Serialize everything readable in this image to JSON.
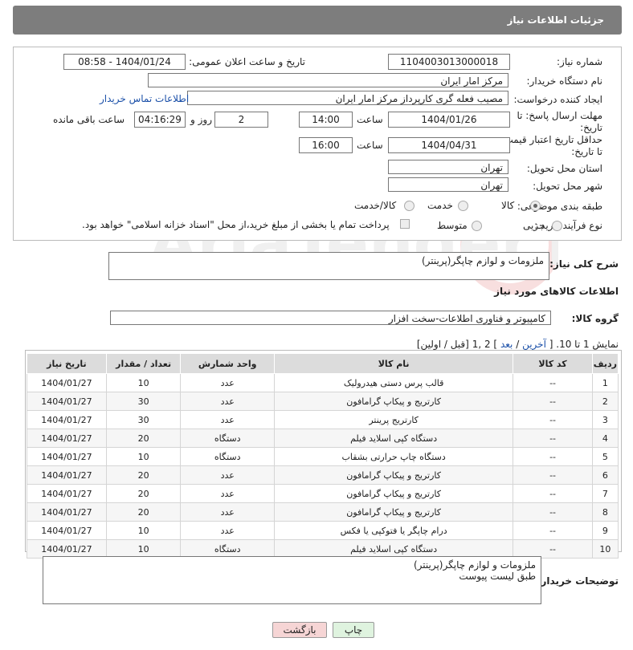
{
  "header": {
    "title": "جزئیات اطلاعات نیاز"
  },
  "form": {
    "need_number_label": "شماره نیاز:",
    "need_number": "1104003013000018",
    "announce_label": "تاریخ و ساعت اعلان عمومی:",
    "announce_value": "1404/01/24 - 08:58",
    "buyer_org_label": "نام دستگاه خریدار:",
    "buyer_org": "مرکز امار ایران",
    "creator_label": "ایجاد کننده درخواست:",
    "creator": "مصیب فعله گری کارپرداز مرکز امار ایران",
    "contact_link": "اطلاعات تماس خریدار",
    "deadline_label_1": "مهلت ارسال پاسخ: تا",
    "deadline_label_2": "تاریخ:",
    "deadline_date": "1404/01/26",
    "time_label": "ساعت",
    "deadline_time": "14:00",
    "days_value": "2",
    "days_label": "روز و",
    "remaining_time": "04:16:29",
    "remaining_label": "ساعت باقی مانده",
    "price_valid_label_1": "حداقل تاریخ اعتبار قیمت:",
    "price_valid_label_2": "تا تاریخ:",
    "price_valid_date": "1404/04/31",
    "price_valid_time": "16:00",
    "province_label": "استان محل تحویل:",
    "province": "تهران",
    "city_label": "شهر محل تحویل:",
    "city": "تهران",
    "category_label": "طبقه بندی موضوعی:",
    "category_options": [
      "کالا",
      "خدمت",
      "کالا/خدمت"
    ],
    "process_label": "نوع فرآیند خرید :",
    "process_options": [
      "جزیی",
      "متوسط"
    ],
    "payment_note": "پرداخت تمام یا بخشی از مبلغ خرید،از محل \"اسناد خزانه اسلامی\" خواهد بود."
  },
  "description": {
    "label": "شرح کلی نیاز:",
    "value": "ملزومات و لوازم چاپگر(پرینتر)"
  },
  "goods_info_title": "اطلاعات کالاهای مورد نیاز",
  "goods_group": {
    "label": "گروه کالا:",
    "value": "کامپیوتر و فناوری اطلاعات-سخت افزار"
  },
  "pagination": {
    "prefix": "نمایش 1 تا 10. [",
    "last": "آخرین",
    "sep1": " / ",
    "next": "بعد",
    "pages": "] 2 ,1",
    "page2": "2",
    "suffix": " [قبل / اولین]"
  },
  "table": {
    "headers": [
      "ردیف",
      "کد کالا",
      "نام کالا",
      "واحد شمارش",
      "تعداد / مقدار",
      "تاریخ نیاز"
    ],
    "rows": [
      [
        "1",
        "--",
        "قالب پرس دستی هیدرولیک",
        "عدد",
        "10",
        "1404/01/27"
      ],
      [
        "2",
        "--",
        "کارتریج و پیکاپ گرامافون",
        "عدد",
        "30",
        "1404/01/27"
      ],
      [
        "3",
        "--",
        "کارتریج پرینتر",
        "عدد",
        "30",
        "1404/01/27"
      ],
      [
        "4",
        "--",
        "دستگاه کپی اسلاید فیلم",
        "دستگاه",
        "20",
        "1404/01/27"
      ],
      [
        "5",
        "--",
        "دستگاه چاپ حرارتی بشقاب",
        "دستگاه",
        "10",
        "1404/01/27"
      ],
      [
        "6",
        "--",
        "کارتریج و پیکاپ گرامافون",
        "عدد",
        "20",
        "1404/01/27"
      ],
      [
        "7",
        "--",
        "کارتریج و پیکاپ گرامافون",
        "عدد",
        "20",
        "1404/01/27"
      ],
      [
        "8",
        "--",
        "کارتریج و پیکاپ گرامافون",
        "عدد",
        "20",
        "1404/01/27"
      ],
      [
        "9",
        "--",
        "درام چاپگر یا فتوکپی یا فکس",
        "عدد",
        "10",
        "1404/01/27"
      ],
      [
        "10",
        "--",
        "دستگاه کپی اسلاید فیلم",
        "دستگاه",
        "10",
        "1404/01/27"
      ]
    ]
  },
  "buyer_notes": {
    "label": "توضیحات خریدار:",
    "value": "ملزومات و لوازم چاپگر(پرینتر)\nطبق لیست پیوست"
  },
  "buttons": {
    "print": "چاپ",
    "back": "بازگشت"
  },
  "colors": {
    "header_bg": "#7d7d7d",
    "link": "#1a4fa8",
    "back_btn": "#f6d5d5",
    "print_btn": "#dff3df"
  }
}
